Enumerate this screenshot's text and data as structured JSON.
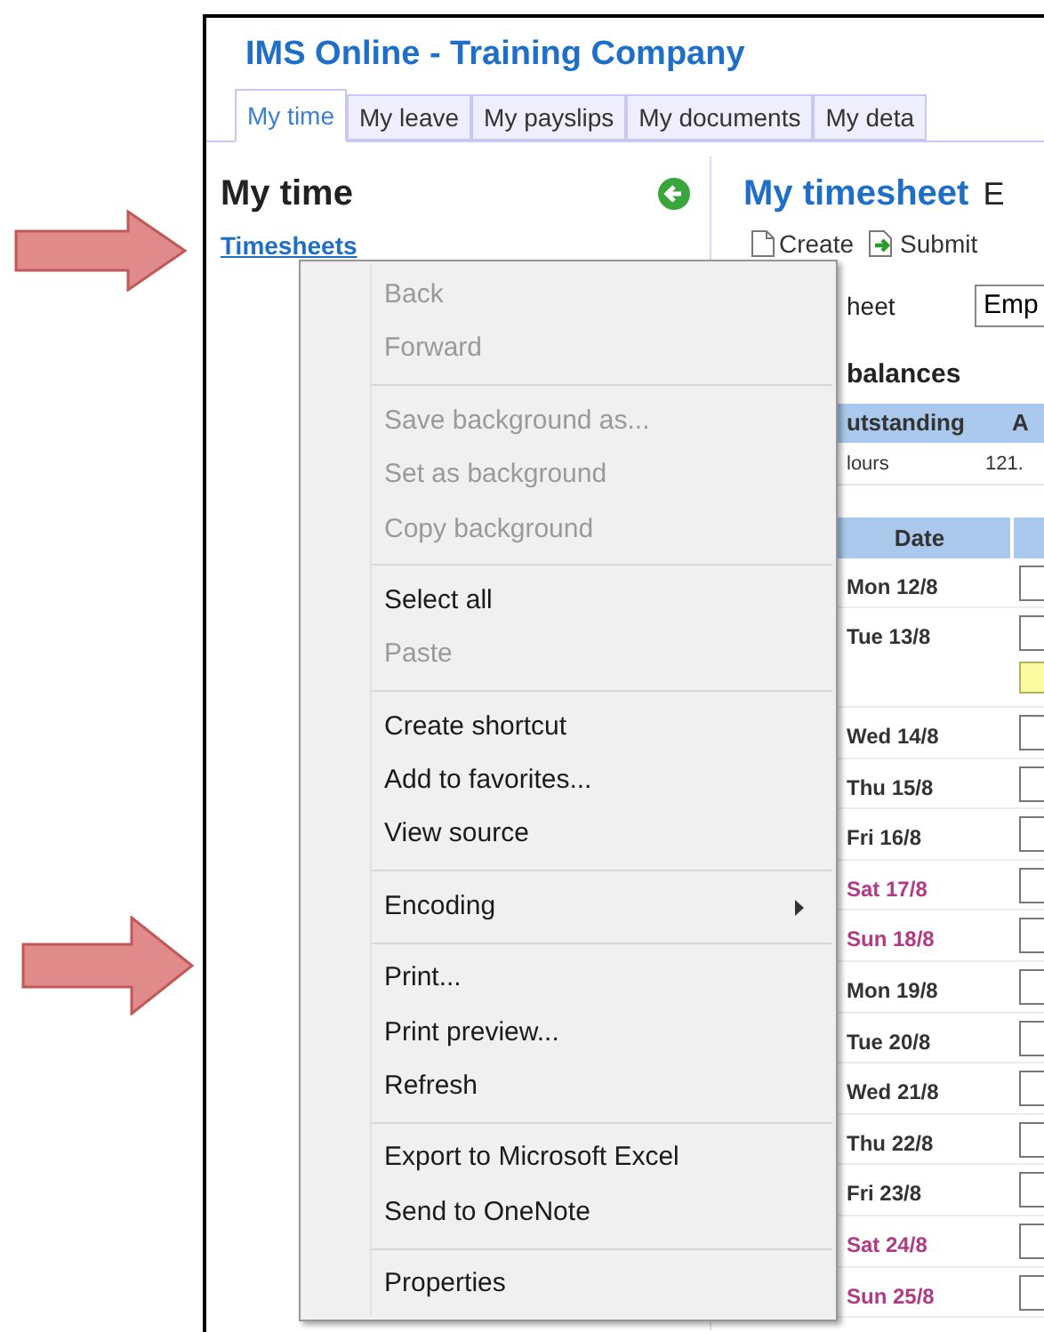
{
  "page_title": "IMS Online - Training Company",
  "tabs": [
    {
      "label": "My time",
      "selected": true
    },
    {
      "label": "My leave",
      "selected": false
    },
    {
      "label": "My payslips",
      "selected": false
    },
    {
      "label": "My documents",
      "selected": false
    },
    {
      "label": "My deta",
      "selected": false
    }
  ],
  "sidebar": {
    "heading": "My time",
    "links": [
      "Timesheets"
    ]
  },
  "main": {
    "heading": "My timesheet",
    "heading_suffix": "E",
    "toolbar": [
      {
        "kind": "create",
        "label": "Create"
      },
      {
        "kind": "submit",
        "label": "Submit"
      }
    ],
    "filter_label": "heet",
    "filter_value": "Emp",
    "balances_heading": "balances",
    "balances_table": {
      "columns": [
        "utstanding",
        "A"
      ],
      "rows": [
        [
          "lours",
          "121."
        ]
      ]
    },
    "timesheet": {
      "columns": [
        "Date"
      ],
      "rows": [
        {
          "date": "Mon 12/8",
          "weekend": false,
          "has_note": false
        },
        {
          "date": "Tue 13/8",
          "weekend": false,
          "has_note": true
        },
        {
          "date": "Wed 14/8",
          "weekend": false,
          "has_note": false
        },
        {
          "date": "Thu 15/8",
          "weekend": false,
          "has_note": false
        },
        {
          "date": "Fri 16/8",
          "weekend": false,
          "has_note": false
        },
        {
          "date": "Sat 17/8",
          "weekend": true,
          "has_note": false
        },
        {
          "date": "Sun 18/8",
          "weekend": true,
          "has_note": false
        },
        {
          "date": "Mon 19/8",
          "weekend": false,
          "has_note": false
        },
        {
          "date": "Tue 20/8",
          "weekend": false,
          "has_note": false
        },
        {
          "date": "Wed 21/8",
          "weekend": false,
          "has_note": false
        },
        {
          "date": "Thu 22/8",
          "weekend": false,
          "has_note": false
        },
        {
          "date": "Fri 23/8",
          "weekend": false,
          "has_note": false
        },
        {
          "date": "Sat 24/8",
          "weekend": true,
          "has_note": false
        },
        {
          "date": "Sun 25/8",
          "weekend": true,
          "has_note": false
        }
      ]
    }
  },
  "context_menu": [
    {
      "kind": "item",
      "label": "Back",
      "disabled": true
    },
    {
      "kind": "item",
      "label": "Forward",
      "disabled": true
    },
    {
      "kind": "separator"
    },
    {
      "kind": "item",
      "label": "Save background as...",
      "disabled": true
    },
    {
      "kind": "item",
      "label": "Set as background",
      "disabled": true
    },
    {
      "kind": "item",
      "label": "Copy background",
      "disabled": true
    },
    {
      "kind": "separator"
    },
    {
      "kind": "item",
      "label": "Select all",
      "disabled": false
    },
    {
      "kind": "item",
      "label": "Paste",
      "disabled": true
    },
    {
      "kind": "separator"
    },
    {
      "kind": "item",
      "label": "Create shortcut",
      "disabled": false
    },
    {
      "kind": "item",
      "label": "Add to favorites...",
      "disabled": false
    },
    {
      "kind": "item",
      "label": "View source",
      "disabled": false
    },
    {
      "kind": "separator"
    },
    {
      "kind": "submenu",
      "label": "Encoding",
      "disabled": false
    },
    {
      "kind": "separator"
    },
    {
      "kind": "item",
      "label": "Print...",
      "disabled": false
    },
    {
      "kind": "item",
      "label": "Print preview...",
      "disabled": false
    },
    {
      "kind": "item",
      "label": "Refresh",
      "disabled": false
    },
    {
      "kind": "separator"
    },
    {
      "kind": "item",
      "label": "Export to Microsoft Excel",
      "disabled": false
    },
    {
      "kind": "item",
      "label": "Send to OneNote",
      "disabled": false
    },
    {
      "kind": "separator"
    },
    {
      "kind": "item",
      "label": "Properties",
      "disabled": false
    }
  ]
}
